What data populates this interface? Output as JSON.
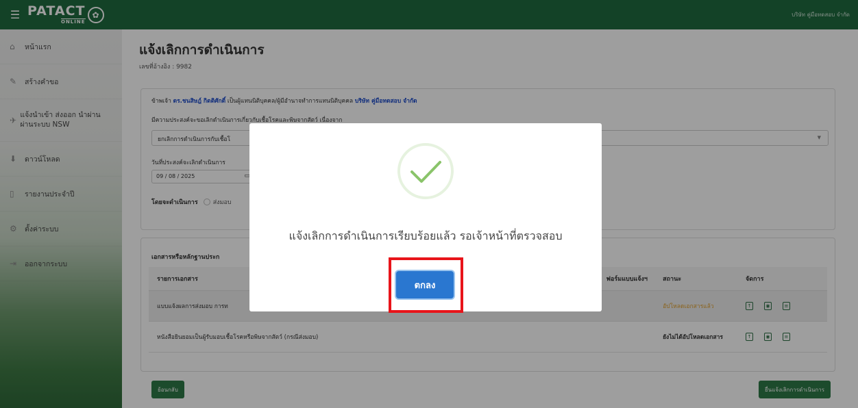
{
  "header": {
    "logo_main": "PATACT",
    "logo_sub": "ONLINE",
    "company": "บริษัท คู่มือทดสอบ จำกัด"
  },
  "sidebar": {
    "items": [
      {
        "label": "หน้าแรก",
        "icon": "home-icon"
      },
      {
        "label": "สร้างคำขอ",
        "icon": "pencil-icon"
      },
      {
        "label": "แจ้งนำเข้า ส่งออก นำผ่าน ผ่านระบบ NSW",
        "icon": "airplane-icon"
      },
      {
        "label": "ดาวน์โหลด",
        "icon": "download-icon"
      },
      {
        "label": "รายงานประจำปี",
        "icon": "file-icon"
      },
      {
        "label": "ตั้งค่าระบบ",
        "icon": "gear-icon"
      },
      {
        "label": "ออกจากระบบ",
        "icon": "logout-icon"
      }
    ]
  },
  "page": {
    "title": "แจ้งเลิกการดำเนินการ",
    "ref": "เลขที่อ้างอิง : 9982"
  },
  "form": {
    "decl_prefix": "ข้าพเจ้า",
    "decl_name": "ดร.ชนสิษฎ์ กิตติศักดิ์",
    "decl_mid": "เป็นผู้แทนนิติบุคคล/ผู้มีอำนาจทำการแทนนิติบุคคล",
    "decl_company": "บริษัท คู่มือทดสอบ จำกัด",
    "intent_label": "มีความประสงค์จะขอเลิกดำเนินการเกี่ยวกับเชื้อโรคและพิษจากสัตว์ เนื่องจาก",
    "select_value": "ยกเลิกการดำเนินการกับเชื้อโ",
    "date_label": "วันที่ประสงค์จะเลิกดำเนินการ",
    "date_value": "09 / 08 / 2025",
    "by_label": "โดยจะดำเนินการ",
    "by_option": "ส่งมอบ"
  },
  "docs": {
    "title": "เอกสารหรือหลักฐานประก",
    "headers": {
      "doc": "รายการเอกสาร",
      "form": "ฟอร์มแบบแจ้งฯ",
      "status": "สถานะ",
      "action": "จัดการ"
    },
    "rows": [
      {
        "doc": "แบบแจ้งผลการส่งมอบ การท",
        "status": "อัปโหลดเอกสารแล้ว"
      },
      {
        "doc": "หนังสือยินยอมเป็นผู้รับมอบเชื้อโรคหรือพิษจากสัตว์ (กรณีส่งมอบ)",
        "status": "ยังไม่ได้อัปโหลดเอกสาร"
      }
    ]
  },
  "buttons": {
    "back": "ย้อนกลับ",
    "submit": "ยื่นแจ้งเลิกการดำเนินการ"
  },
  "modal": {
    "message": "แจ้งเลิกการดำเนินการเรียบร้อยแล้ว รอเจ้าหน้าที่ตรวจสอบ",
    "ok": "ตกลง"
  }
}
